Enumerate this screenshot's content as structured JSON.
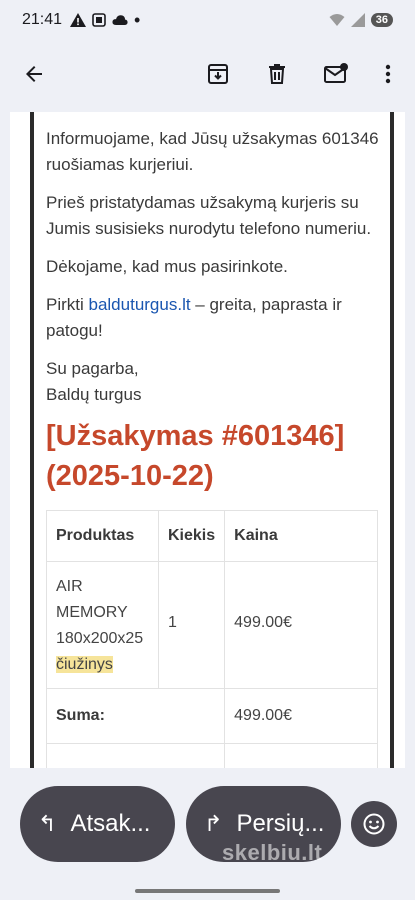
{
  "status_bar": {
    "time": "21:41",
    "battery": "36",
    "icons": [
      "warning-icon",
      "screenshot-icon",
      "cloud-icon",
      "dot-icon",
      "wifi-icon",
      "signal-icon"
    ]
  },
  "toolbar": {
    "back_icon": "arrow-back-icon",
    "archive_icon": "archive-icon",
    "delete_icon": "trash-icon",
    "mark_unread_icon": "mail-unread-icon",
    "more_icon": "more-vert-icon"
  },
  "email": {
    "p1": "Informuojame, kad Jūsų užsakymas 601346 ruošiamas kurjeriui.",
    "p2": "Prieš pristatydamas užsakymą kurjeris su Jumis susisieks nurodytu telefono numeriu.",
    "p3": "Dėkojame, kad mus pasirinkote.",
    "p4_prefix": "Pirkti ",
    "p4_link": "balduturgus.lt",
    "p4_suffix": " – greita, paprasta ir patogu!",
    "sign1": "Su pagarba,",
    "sign2": "Baldų turgus",
    "order_heading": "[Užsakymas #601346] (2025-10-22)",
    "table": {
      "headers": [
        "Produktas",
        "Kiekis",
        "Kaina"
      ],
      "rows": [
        {
          "product": "AIR MEMORY 180x200x25",
          "product_highlight": "čiužinys",
          "qty": "1",
          "price": "499.00€"
        }
      ],
      "sum_label": "Suma:",
      "sum_value": "499.00€"
    }
  },
  "actions": {
    "reply_label": "Atsak...",
    "forward_label": "Persių...",
    "reply_icon": "reply-icon",
    "forward_icon": "forward-icon",
    "emoji_icon": "emoji-icon"
  },
  "watermark": "skelbiu.lt"
}
